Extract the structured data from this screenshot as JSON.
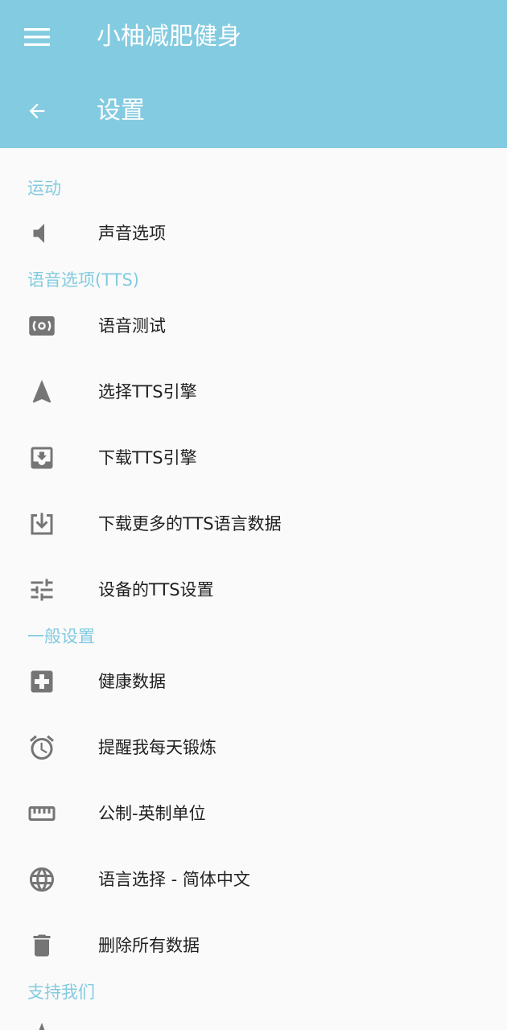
{
  "app": {
    "title": "小柚减肥健身",
    "menu_icon": "menu-icon"
  },
  "toolbar": {
    "title": "设置",
    "back_icon": "arrow-back-icon"
  },
  "colors": {
    "header_bg": "#83cbe0",
    "section_text": "#83cbe0",
    "icon": "#757575",
    "text": "#212121",
    "background": "#fafafa"
  },
  "sections": [
    {
      "title": "运动",
      "items": [
        {
          "label": "声音选项",
          "icon": "volume-icon"
        }
      ]
    },
    {
      "title": "语音选项(TTS)",
      "items": [
        {
          "label": "语音测试",
          "icon": "speaker-test-icon"
        },
        {
          "label": "选择TTS引擎",
          "icon": "navigation-arrow-icon"
        },
        {
          "label": "下载TTS引擎",
          "icon": "download-box-icon"
        },
        {
          "label": "下载更多的TTS语言数据",
          "icon": "download-outline-icon"
        },
        {
          "label": "设备的TTS设置",
          "icon": "tune-icon"
        }
      ]
    },
    {
      "title": "一般设置",
      "items": [
        {
          "label": "健康数据",
          "icon": "health-plus-icon"
        },
        {
          "label": "提醒我每天锻炼",
          "icon": "alarm-icon"
        },
        {
          "label": "公制-英制单位",
          "icon": "ruler-icon"
        },
        {
          "label": "语言选择 - 简体中文",
          "icon": "globe-icon"
        },
        {
          "label": "删除所有数据",
          "icon": "trash-icon"
        }
      ]
    },
    {
      "title": "支持我们",
      "items": []
    }
  ]
}
